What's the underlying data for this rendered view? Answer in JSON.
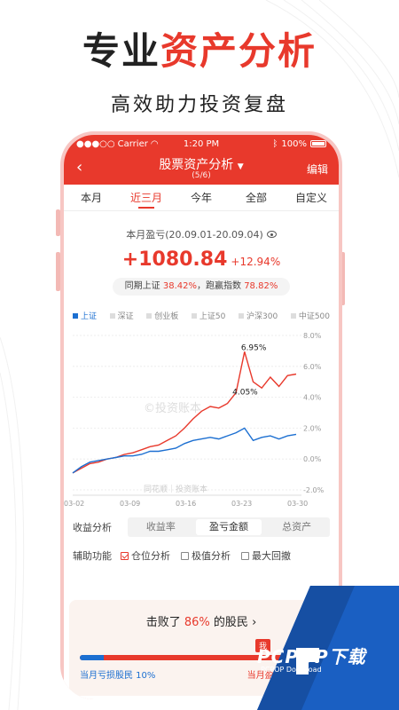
{
  "promo": {
    "headline_dark": "专业",
    "headline_red": "资产分析",
    "subline": "高效助力投资复盘"
  },
  "status_bar": {
    "carrier": "Carrier",
    "time": "1:20 PM",
    "battery": "100%"
  },
  "nav": {
    "back_icon": "chevron-left-icon",
    "title": "股票资产分析",
    "subtitle": "(5/6)",
    "edit_label": "编辑"
  },
  "tabs": [
    {
      "label": "本月",
      "active": false
    },
    {
      "label": "近三月",
      "active": true
    },
    {
      "label": "今年",
      "active": false
    },
    {
      "label": "全部",
      "active": false
    },
    {
      "label": "自定义",
      "active": false
    }
  ],
  "summary": {
    "label": "本月盈亏(20.09.01-20.09.04)",
    "amount": "+1080.84",
    "percent": "+12.94%",
    "compare_prefix": "同期上证",
    "compare_value": "38.42%",
    "compare_mid": "，跑赢指数",
    "compare_beat": "78.82%"
  },
  "legend": [
    {
      "label": "上证",
      "active": true
    },
    {
      "label": "深证",
      "active": false
    },
    {
      "label": "创业板",
      "active": false
    },
    {
      "label": "上证50",
      "active": false
    },
    {
      "label": "沪深300",
      "active": false
    },
    {
      "label": "中证500",
      "active": false
    }
  ],
  "chart_data": {
    "type": "line",
    "x_ticks": [
      "03-02",
      "03-09",
      "03-16",
      "03-23",
      "03-30"
    ],
    "y_ticks": [
      "8.0%",
      "6.0%",
      "4.0%",
      "2.0%",
      "0.0%",
      "-2.0%"
    ],
    "ylim": [
      -2.0,
      8.0
    ],
    "grid": true,
    "watermark": "©投资账本",
    "watermark_bottom": "同花顺｜投资账本",
    "series": [
      {
        "color": "#e8392c",
        "end_label": "6.95%",
        "values": [
          -0.9,
          -0.6,
          -0.3,
          -0.2,
          0.0,
          0.1,
          0.3,
          0.4,
          0.6,
          0.8,
          0.9,
          1.2,
          1.5,
          2.0,
          2.6,
          3.1,
          3.4,
          3.3,
          3.6,
          4.3,
          6.95,
          5.0,
          4.6,
          5.3,
          4.7,
          5.4,
          5.5
        ]
      },
      {
        "color": "#1c6fd1",
        "end_label": "4.05%",
        "values": [
          -0.9,
          -0.5,
          -0.2,
          -0.1,
          0.0,
          0.1,
          0.2,
          0.2,
          0.3,
          0.5,
          0.5,
          0.6,
          0.7,
          1.0,
          1.2,
          1.3,
          1.4,
          1.3,
          1.5,
          1.7,
          2.0,
          1.2,
          1.4,
          1.5,
          1.3,
          1.5,
          1.6
        ]
      }
    ],
    "annotations": [
      {
        "text": "6.95%",
        "x_index": 20,
        "y": 6.95
      },
      {
        "text": "4.05%",
        "x_index": 19,
        "y": 4.05
      }
    ]
  },
  "segment": {
    "label": "收益分析",
    "options": [
      {
        "label": "收益率",
        "active": false
      },
      {
        "label": "盈亏金额",
        "active": true
      },
      {
        "label": "总资产",
        "active": false
      }
    ]
  },
  "aux": {
    "label": "辅助功能",
    "options": [
      {
        "label": "仓位分析",
        "checked": true
      },
      {
        "label": "极值分析",
        "checked": false
      },
      {
        "label": "最大回撤",
        "checked": false
      }
    ]
  },
  "beat": {
    "prefix": "击败了",
    "value": "86%",
    "suffix": "的股民",
    "arrow": "›",
    "me_tag": "我",
    "loss_fraction": 0.1,
    "left_label": "当月亏损股民 10%",
    "right_label": "当月盈利股民 90%"
  },
  "watermark": {
    "brand": "PCPOP下载",
    "sub": "PCPOP Download",
    "color": "#1a5fc2"
  }
}
